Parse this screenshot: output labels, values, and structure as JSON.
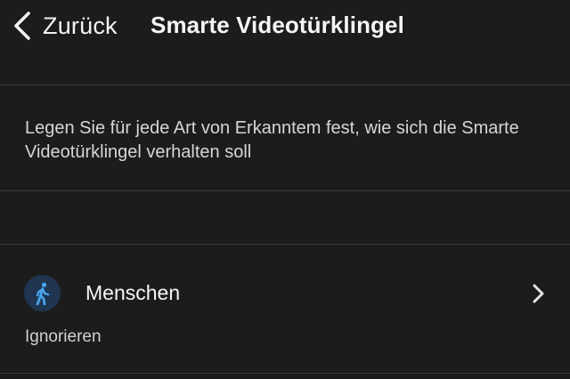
{
  "nav": {
    "back_label": "Zurück",
    "title": "Smarte Videotürklingel",
    "back_icon": "chevron-left-icon"
  },
  "description": {
    "text": "Legen Sie für jede Art von Erkanntem fest, wie sich die Smarte Videotürklingel verhalten soll"
  },
  "detections": [
    {
      "label": "Menschen",
      "status": "Ignorieren",
      "icon": "person-walking-icon",
      "chevron_icon": "chevron-right-icon"
    }
  ],
  "colors": {
    "background": "#1c1c1c",
    "divider": "#3a3a3a",
    "icon_accent": "#4aa3f0",
    "icon_circle": "#1f3550"
  }
}
